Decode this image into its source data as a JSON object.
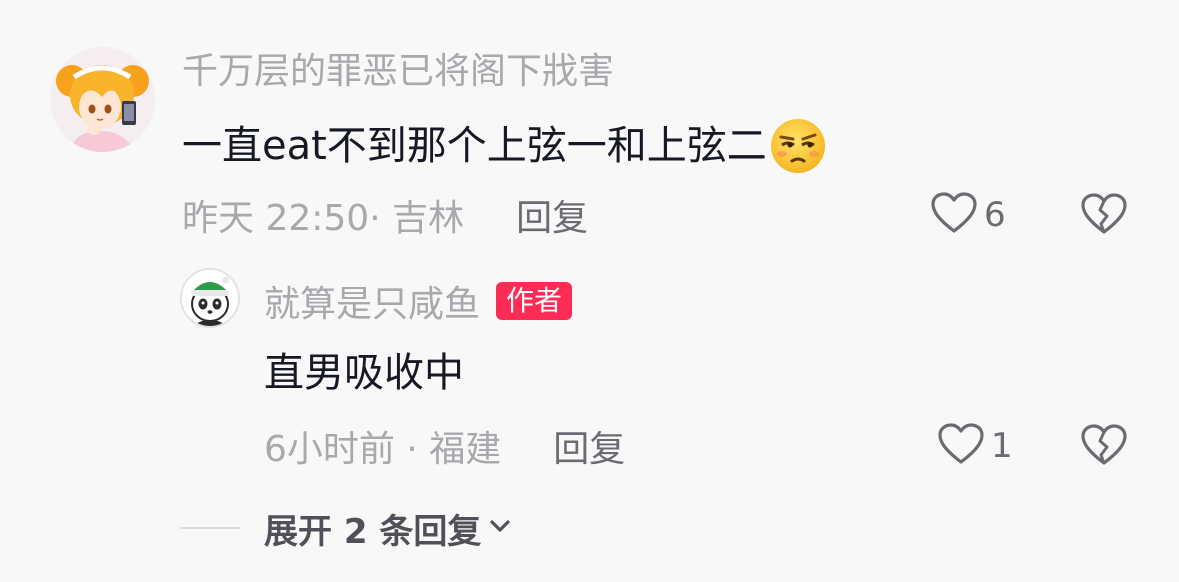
{
  "comment": {
    "username": "千万层的罪恶已将阁下戕害",
    "text": "一直eat不到那个上弦一和上弦二",
    "emoji_icon": "squinting-skeptical-face-emoji",
    "time_location": "昨天 22:50· 吉林",
    "reply_label": "回复",
    "like_count": "6",
    "like_icon": "heart-outline-icon",
    "dislike_icon": "broken-heart-icon"
  },
  "reply": {
    "username": "就算是只咸鱼",
    "badge": "作者",
    "text": "直男吸收中",
    "time_location": "6小时前 · 福建",
    "reply_label": "回复",
    "like_count": "1",
    "like_icon": "heart-outline-icon",
    "dislike_icon": "broken-heart-icon"
  },
  "expand": {
    "label": "展开 2 条回复",
    "icon": "chevron-down-icon"
  },
  "colors": {
    "background": "#f8f8f8",
    "muted_text": "#a8a8ad",
    "primary_text": "#161823",
    "secondary_text": "#6b6c72",
    "author_badge": "#fe2c55"
  }
}
